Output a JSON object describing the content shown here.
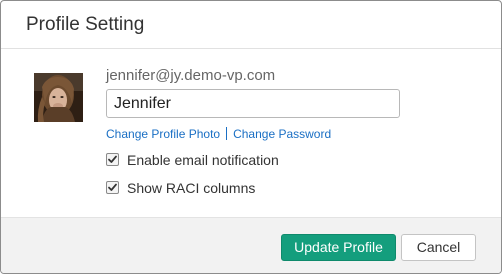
{
  "dialog": {
    "title": "Profile Setting"
  },
  "profile": {
    "email": "jennifer@jy.demo-vp.com",
    "name_value": "Jennifer",
    "avatar_alt": "avatar"
  },
  "links": {
    "change_photo": "Change Profile Photo",
    "change_password": "Change Password"
  },
  "options": [
    {
      "label": "Enable email notification",
      "checked": true
    },
    {
      "label": "Show RACI columns",
      "checked": true
    }
  ],
  "footer": {
    "update_label": "Update Profile",
    "cancel_label": "Cancel"
  },
  "colors": {
    "primary": "#149e7d",
    "link": "#1a6fc4"
  },
  "icons": {
    "checkbox_checked": "checkmark-icon"
  }
}
